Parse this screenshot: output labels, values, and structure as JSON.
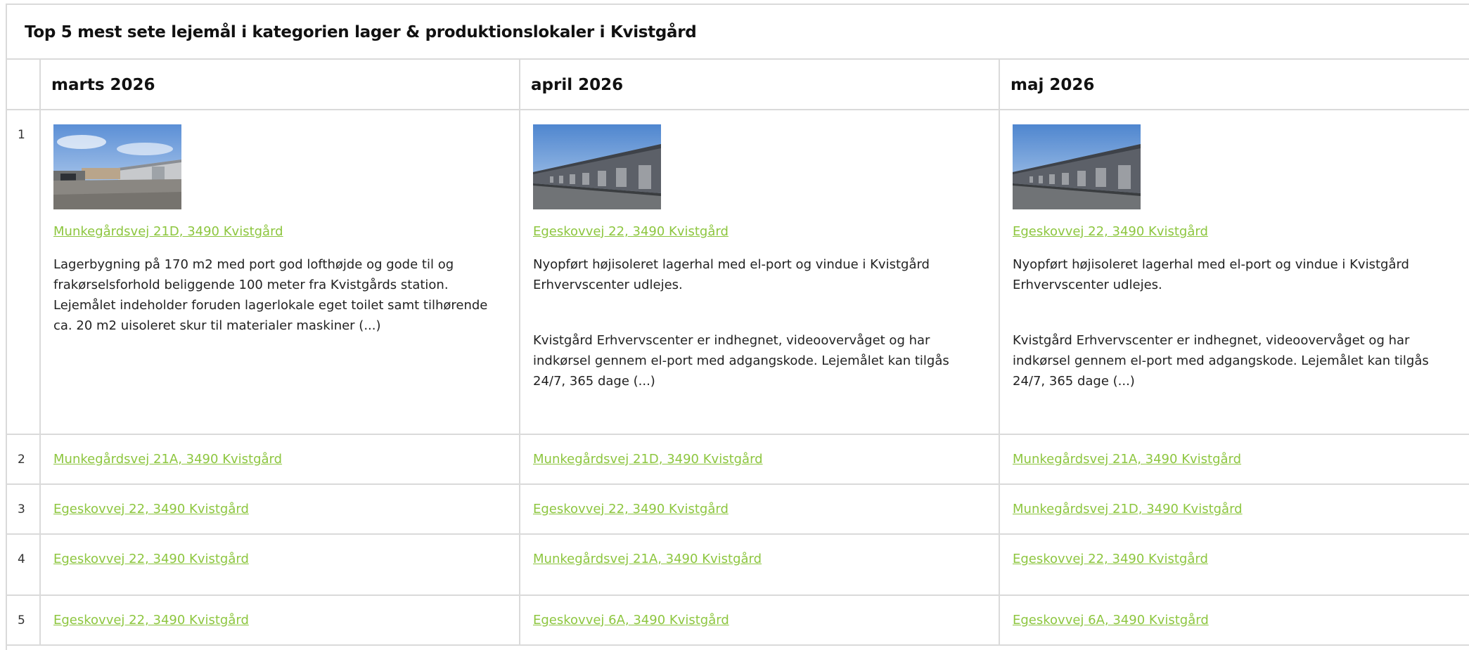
{
  "widget": {
    "title": "Top 5 mest sete lejemål i kategorien lager & produktionslokaler i Kvistgård"
  },
  "months": [
    {
      "label": "marts 2026"
    },
    {
      "label": "april 2026"
    },
    {
      "label": "maj 2026"
    }
  ],
  "ranks": [
    "1",
    "2",
    "3",
    "4",
    "5"
  ],
  "top": {
    "march": {
      "address": "Munkegårdsvej 21D, 3490 Kvistgård",
      "image": "building-photo",
      "paragraphs": [
        "Lagerbygning på 170 m2 med port god lofthøjde og gode til og frakørselsforhold beliggende 100 meter fra Kvistgårds station. Lejemålet indeholder foruden lagerlokale eget toilet samt tilhørende ca. 20 m2 uisoleret skur til materialer maskiner (...)"
      ]
    },
    "april": {
      "address": "Egeskovvej 22, 3490 Kvistgård",
      "image": "warehouse-row-photo",
      "paragraphs": [
        "Nyopført højisoleret lagerhal med el-port og vindue i Kvistgård Erhvervscenter udlejes.",
        "Kvistgård Erhvervscenter er indhegnet, videoovervåget og har indkørsel gennem el-port med adgangskode. Lejemålet kan tilgås 24/7, 365 dage (...)"
      ]
    },
    "may": {
      "address": "Egeskovvej 22, 3490 Kvistgård",
      "image": "warehouse-row-photo",
      "paragraphs": [
        "Nyopført højisoleret lagerhal med el-port og vindue i Kvistgård Erhvervscenter udlejes.",
        "Kvistgård Erhvervscenter er indhegnet, videoovervåget og har indkørsel gennem el-port med adgangskode. Lejemålet kan tilgås 24/7, 365 dage (...)"
      ]
    }
  },
  "rows": [
    {
      "march": "Munkegårdsvej 21A, 3490 Kvistgård",
      "april": "Munkegårdsvej 21D, 3490 Kvistgård",
      "may": "Munkegårdsvej 21A, 3490 Kvistgård"
    },
    {
      "march": "Egeskovvej 22, 3490 Kvistgård",
      "april": "Egeskovvej 22, 3490 Kvistgård",
      "may": "Munkegårdsvej 21D, 3490 Kvistgård"
    },
    {
      "march": "Egeskovvej 22, 3490 Kvistgård",
      "april": "Munkegårdsvej 21A, 3490 Kvistgård",
      "may": "Egeskovvej 22, 3490 Kvistgård"
    },
    {
      "march": "Egeskovvej 22, 3490 Kvistgård",
      "april": "Egeskovvej 6A, 3490 Kvistgård",
      "may": "Egeskovvej 6A, 3490 Kvistgård"
    }
  ],
  "colors": {
    "link": "#8dc63f",
    "border": "#dadada"
  }
}
